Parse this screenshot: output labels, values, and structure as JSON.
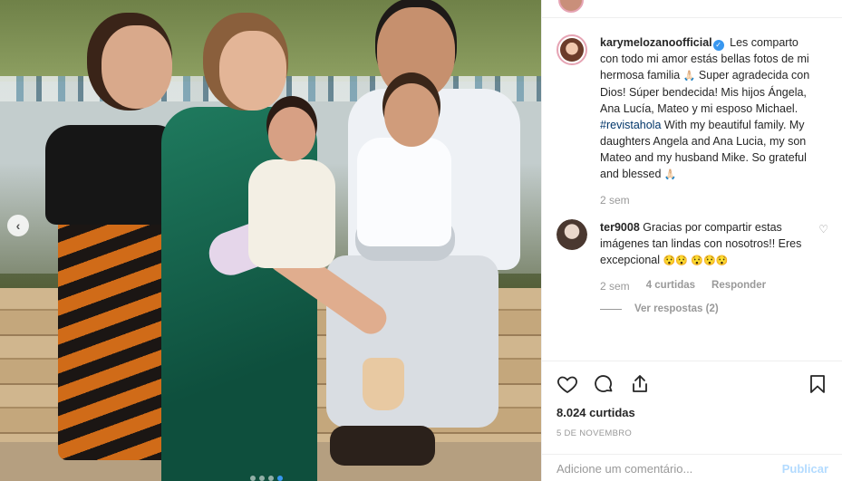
{
  "post": {
    "username": "karymelozanoofficial",
    "caption": {
      "part1": "Les comparto con todo mi amor estás bellas fotos de mi hermosa familia",
      "part2": "Super agradecida con Dios! Súper bendecida! Mis hijos Ángela, Ana Lucía, Mateo y mi esposo Michael.",
      "hashtag": "#revistahola",
      "part3": "With my beautiful family. My daughters Angela and Ana Lucia, my son Mateo and my husband Mike. So grateful and blessed"
    },
    "time_ago": "2 sem",
    "likes": "8.024 curtidas",
    "date": "5 DE NOVEMBRO"
  },
  "comment": {
    "username": "ter9008",
    "text": "Gracias por compartir estas imágenes tan lindas con nosotros!! Eres excepcional",
    "emoji_after_text": "😯😯",
    "emoji_line": "😯😯😯",
    "time_ago": "2 sem",
    "likes": "4 curtidas",
    "reply_label": "Responder",
    "view_replies": "Ver respostas (2)"
  },
  "composer": {
    "placeholder": "Adicione um comentário...",
    "publish_label": "Publicar"
  },
  "icons": {
    "verified": "verified-badge-icon",
    "like": "heart-icon",
    "comment": "comment-bubble-icon",
    "share": "share-icon",
    "save": "bookmark-icon",
    "comment_like": "small-heart-icon",
    "prev": "chevron-left-icon",
    "family_emoji": "🙏🏻"
  },
  "colors": {
    "accent": "#3897f0",
    "hashtag": "#003569",
    "muted": "#999999",
    "publish_disabled": "#b3dbff"
  },
  "carousel": {
    "total": 4,
    "active": 4
  }
}
